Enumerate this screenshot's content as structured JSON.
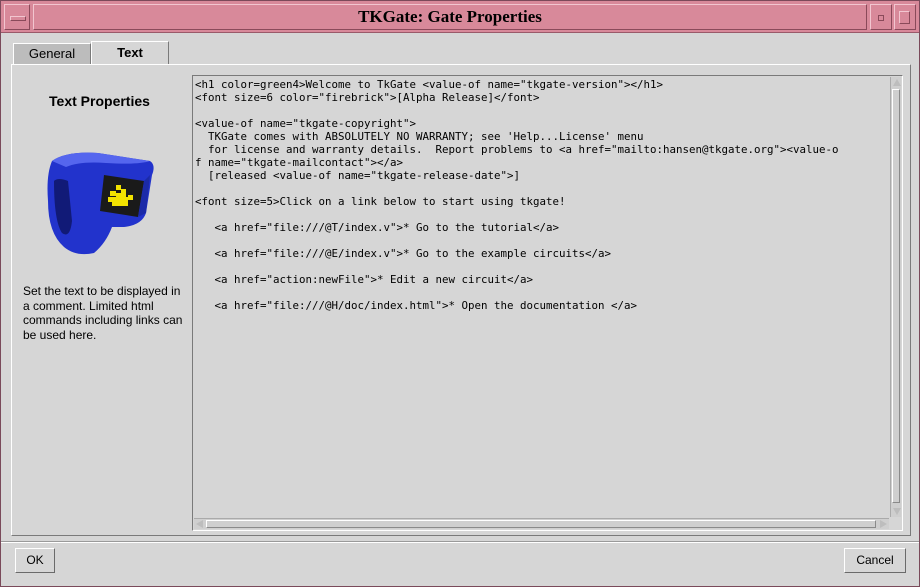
{
  "window": {
    "title": "TKGate: Gate Properties"
  },
  "tabs": [
    {
      "label": "General"
    },
    {
      "label": "Text"
    }
  ],
  "sidebar": {
    "heading": "Text Properties",
    "description": "Set the text to be displayed in a comment. Limited html commands including links can be used here."
  },
  "editor": {
    "content": "<h1 color=green4>Welcome to TkGate <value-of name=\"tkgate-version\"></h1>\n<font size=6 color=\"firebrick\">[Alpha Release]</font>\n\n<value-of name=\"tkgate-copyright\">\n  TKGate comes with ABSOLUTELY NO WARRANTY; see 'Help...License' menu\n  for license and warranty details.  Report problems to <a href=\"mailto:hansen@tkgate.org\"><value-o\nf name=\"tkgate-mailcontact\"></a>\n  [released <value-of name=\"tkgate-release-date\">]\n\n<font size=5>Click on a link below to start using tkgate!\n\n   <a href=\"file:///@T/index.v\">* Go to the tutorial</a>\n\n   <a href=\"file:///@E/index.v\">* Go to the example circuits</a>\n\n   <a href=\"action:newFile\">* Edit a new circuit</a>\n\n   <a href=\"file:///@H/doc/index.html\">* Open the documentation </a>"
  },
  "buttons": {
    "ok": "OK",
    "cancel": "Cancel"
  },
  "colors": {
    "titlebar": "#d8899a",
    "background": "#d6d6d6",
    "gate_body": "#2233cc",
    "gate_display": "#1a1a1a",
    "gate_glyph": "#f2e200"
  },
  "icons": [
    "window-menu-icon",
    "minimize-icon",
    "maximize-icon",
    "comment-gate-icon"
  ]
}
